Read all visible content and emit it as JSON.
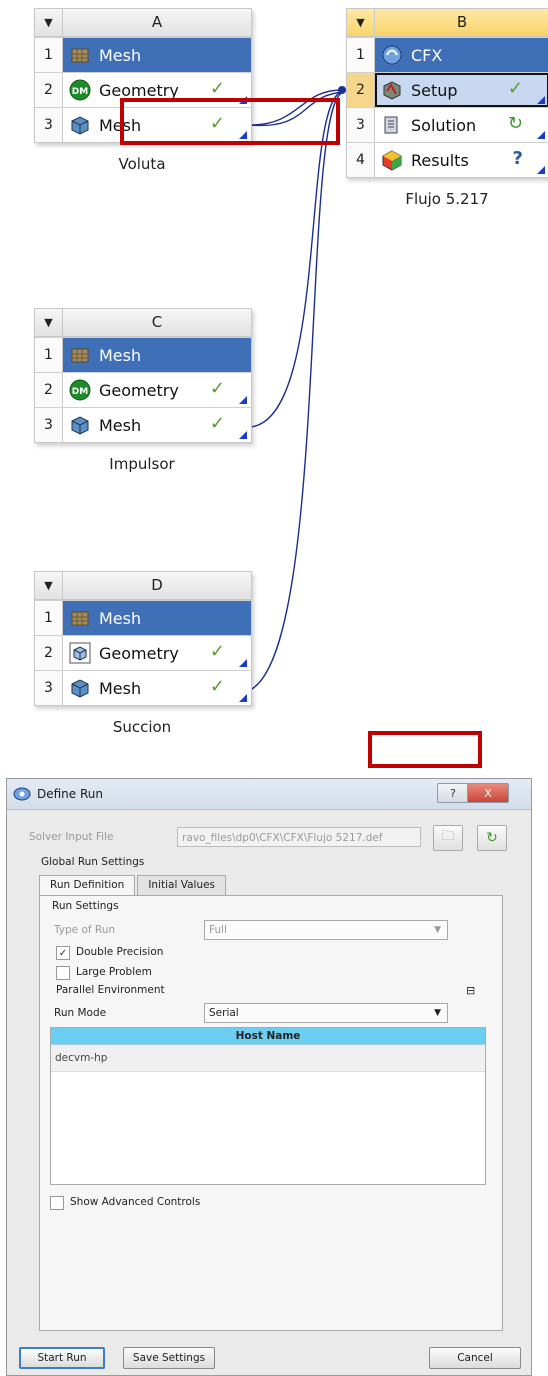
{
  "colors": {
    "accent": "#3f6fb6",
    "selected_header": "#f9d46a",
    "check": "#5a9a2a",
    "link_line": "#1c2f8c",
    "highlight_box": "#c00000",
    "host_header": "#6ccff2"
  },
  "systems": [
    {
      "id": "A",
      "letter": "A",
      "label": "Voluta",
      "rows": [
        {
          "num": "1",
          "name": "Mesh",
          "icon": "mesh-system-icon",
          "status": ""
        },
        {
          "num": "2",
          "name": "Geometry",
          "icon": "designmodeler-icon",
          "status": "check"
        },
        {
          "num": "3",
          "name": "Mesh",
          "icon": "mesh-cell-icon",
          "status": "check"
        }
      ]
    },
    {
      "id": "B",
      "letter": "B",
      "label": "Flujo 5.217",
      "rows": [
        {
          "num": "1",
          "name": "CFX",
          "icon": "cfx-icon",
          "status": ""
        },
        {
          "num": "2",
          "name": "Setup",
          "icon": "setup-icon",
          "status": "check"
        },
        {
          "num": "3",
          "name": "Solution",
          "icon": "solution-icon",
          "status": "refresh"
        },
        {
          "num": "4",
          "name": "Results",
          "icon": "results-icon",
          "status": "query"
        }
      ]
    },
    {
      "id": "C",
      "letter": "C",
      "label": "Impulsor",
      "rows": [
        {
          "num": "1",
          "name": "Mesh",
          "icon": "mesh-system-icon",
          "status": ""
        },
        {
          "num": "2",
          "name": "Geometry",
          "icon": "designmodeler-icon",
          "status": "check"
        },
        {
          "num": "3",
          "name": "Mesh",
          "icon": "mesh-cell-icon",
          "status": "check"
        }
      ]
    },
    {
      "id": "D",
      "letter": "D",
      "label": "Succion",
      "rows": [
        {
          "num": "1",
          "name": "Mesh",
          "icon": "mesh-system-icon",
          "status": ""
        },
        {
          "num": "2",
          "name": "Geometry",
          "icon": "geometry-cube-icon",
          "status": "check"
        },
        {
          "num": "3",
          "name": "Mesh",
          "icon": "mesh-cell-icon",
          "status": "check"
        }
      ]
    }
  ],
  "status_glyphs": {
    "check": "✓",
    "refresh": "↻",
    "query": "?"
  },
  "dialog": {
    "title": "Define Run",
    "help_button": "?",
    "close_button": "X",
    "solver_input_label": "Solver Input File",
    "solver_input_value": "ravo_files\\dp0\\CFX\\CFX\\Flujo 5217.def",
    "global_run_settings": "Global Run Settings",
    "tabs": [
      "Run Definition",
      "Initial Values"
    ],
    "run_settings": "Run Settings",
    "type_of_run_label": "Type of Run",
    "type_of_run_value": "Full",
    "double_precision": "Double Precision",
    "double_precision_checked": true,
    "large_problem": "Large Problem",
    "large_problem_checked": false,
    "parallel_environment": "Parallel Environment",
    "run_mode_label": "Run Mode",
    "run_mode_value": "Serial",
    "host_header": "Host Name",
    "hosts": [
      "decvm-hp"
    ],
    "show_advanced": "Show Advanced Controls",
    "show_advanced_checked": false,
    "start_run": "Start Run",
    "save_settings": "Save Settings",
    "cancel": "Cancel"
  }
}
